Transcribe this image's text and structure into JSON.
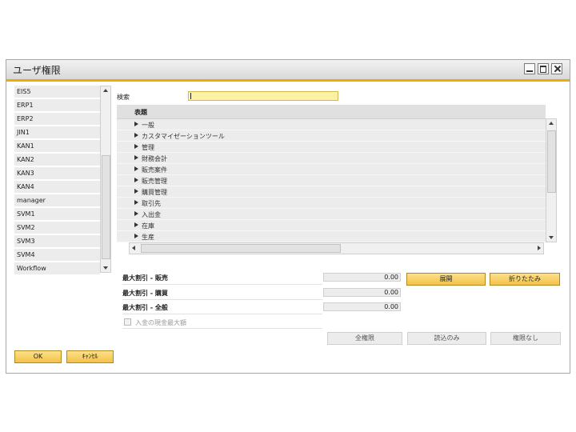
{
  "window": {
    "title": "ユーザ権限"
  },
  "users": [
    "EIS5",
    "ERP1",
    "ERP2",
    "JIN1",
    "KAN1",
    "KAN2",
    "KAN3",
    "KAN4",
    "manager",
    "SVM1",
    "SVM2",
    "SVM3",
    "SVM4",
    "Workflow"
  ],
  "search": {
    "label": "検索",
    "value": ""
  },
  "tree": {
    "header": "表題",
    "nodes": [
      "一般",
      "カスタマイゼーションツール",
      "管理",
      "財務会計",
      "販売案件",
      "販売管理",
      "購買管理",
      "取引先",
      "入出金",
      "在庫",
      "生産"
    ]
  },
  "fields": [
    {
      "label": "最大割引 - 販売",
      "value": "0.00"
    },
    {
      "label": "最大割引 - 購買",
      "value": "0.00"
    },
    {
      "label": "最大割引 - 全般",
      "value": "0.00"
    }
  ],
  "checkbox": {
    "label": "入金の現金最大額"
  },
  "buttons": {
    "expand": "展開",
    "collapse": "折りたたみ",
    "full": "全権限",
    "readonly": "読込のみ",
    "none": "権限なし",
    "ok": "OK",
    "cancel": "ｷｬﾝｾﾙ"
  },
  "colors": {
    "accent": "#f0ab00",
    "search_bg": "#fdf1a8"
  }
}
